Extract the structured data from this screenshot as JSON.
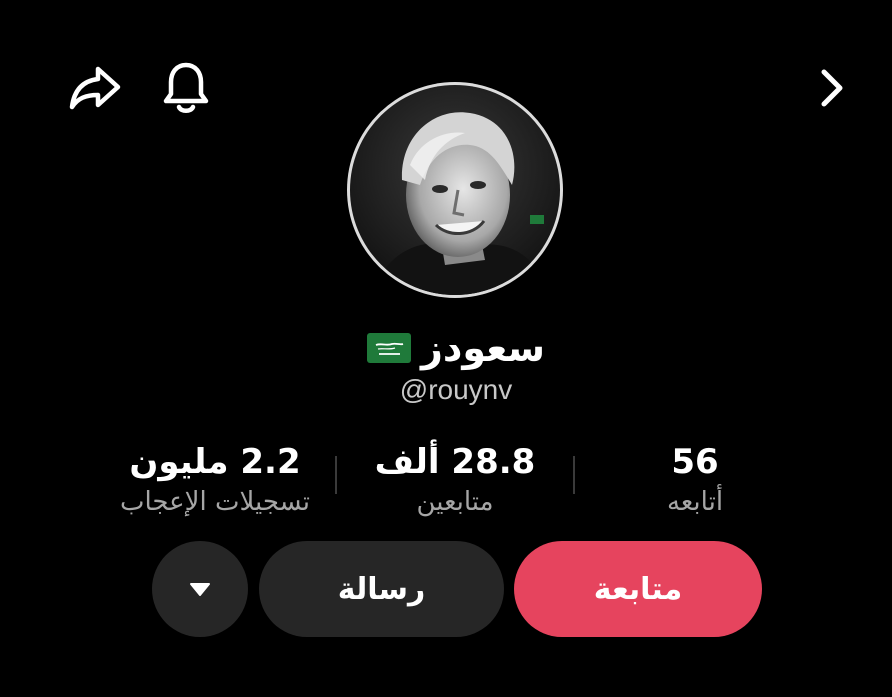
{
  "header": {
    "share_icon": "share-arrow-icon",
    "bell_icon": "bell-icon",
    "next_icon": "chevron-right-icon"
  },
  "profile": {
    "display_name": "سعودز",
    "flag_icon": "saudi-flag-icon",
    "username": "@rouynv"
  },
  "stats": {
    "following": {
      "value": "56",
      "label": "أتابعه"
    },
    "followers": {
      "value": "28.8 ألف",
      "label": "متابعين"
    },
    "likes": {
      "value": "2.2 مليون",
      "label": "تسجيلات الإعجاب"
    }
  },
  "actions": {
    "follow_label": "متابعة",
    "message_label": "رسالة",
    "more_icon": "triangle-down-icon"
  },
  "colors": {
    "background": "#000000",
    "follow_button": "#e6445e",
    "secondary_button": "#262626",
    "muted_text": "#a6a6a6",
    "flag_green": "#1f7a3a"
  }
}
